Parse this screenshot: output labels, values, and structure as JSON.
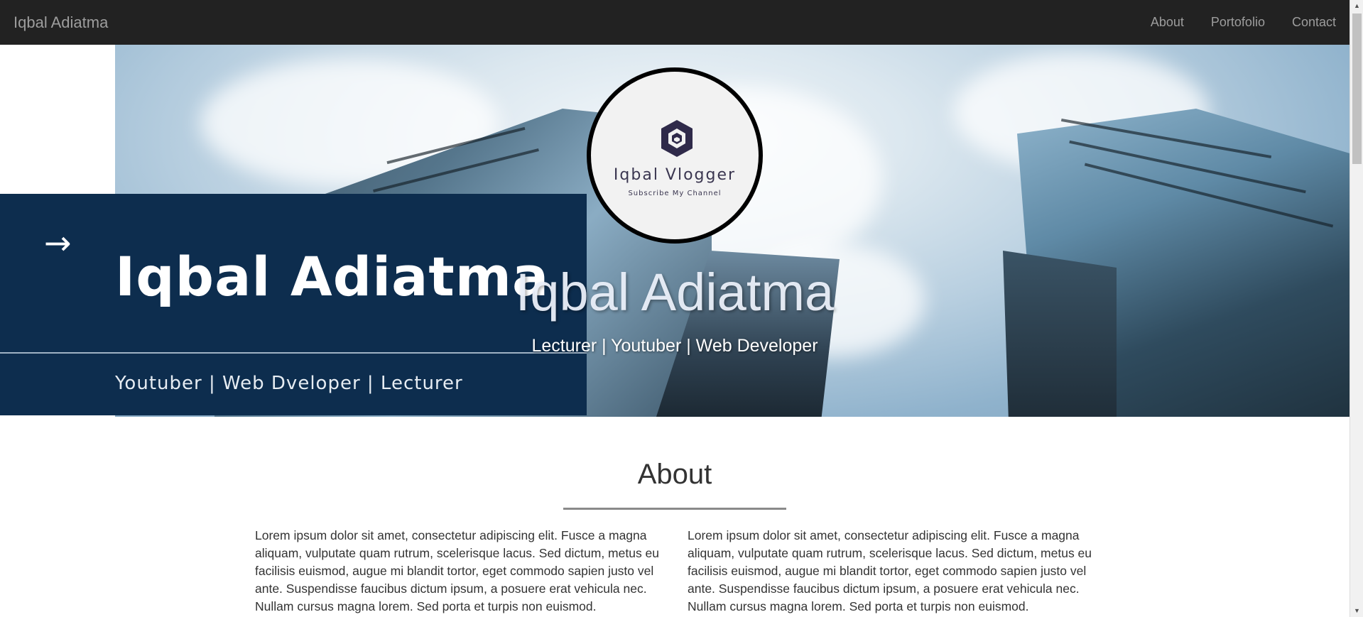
{
  "navbar": {
    "brand": "Iqbal Adiatma",
    "links": [
      {
        "label": "About"
      },
      {
        "label": "Portofolio"
      },
      {
        "label": "Contact"
      }
    ]
  },
  "hero": {
    "banner": {
      "arrow": "→",
      "title": "Iqbal Adiatma",
      "subtitle": "Youtuber | Web Dveloper | Lecturer"
    },
    "logo": {
      "name": "Iqbal Vlogger",
      "tagline": "Subscribe My Channel",
      "icon": "cube-logo-icon"
    },
    "name": "Iqbal Adiatma",
    "tagline": "Lecturer | Youtuber | Web Developer"
  },
  "about": {
    "title": "About",
    "left_text": "Lorem ipsum dolor sit amet, consectetur adipiscing elit. Fusce a magna aliquam, vulputate quam rutrum, scelerisque lacus. Sed dictum, metus eu facilisis euismod, augue mi blandit tortor, eget commodo sapien justo vel ante. Suspendisse faucibus dictum ipsum, a posuere erat vehicula nec. Nullam cursus magna lorem. Sed porta et turpis non euismod.",
    "right_text": "Lorem ipsum dolor sit amet, consectetur adipiscing elit. Fusce a magna aliquam, vulputate quam rutrum, scelerisque lacus. Sed dictum, metus eu facilisis euismod, augue mi blandit tortor, eget commodo sapien justo vel ante. Suspendisse faucibus dictum ipsum, a posuere erat vehicula nec. Nullam cursus magna lorem. Sed porta et turpis non euismod."
  },
  "colors": {
    "navbar_bg": "#222222",
    "nav_text": "#9d9d9d",
    "banner_bg": "#0d2d4e"
  }
}
